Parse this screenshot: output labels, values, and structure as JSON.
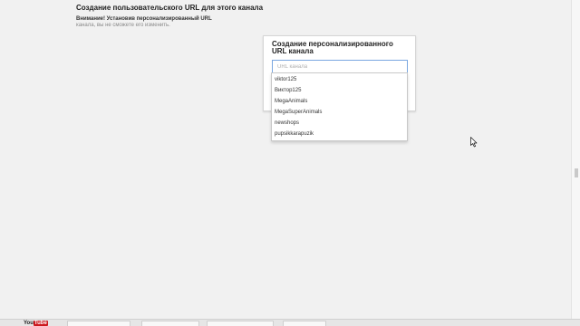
{
  "heading": "Создание пользовательского URL для этого канала",
  "warning": {
    "label": "Внимание! Установив персонализированный URL",
    "line2": "канала, вы не сможете его изменить."
  },
  "dialog": {
    "title": "Создание персонализированного URL канала",
    "input_placeholder": "URL канала",
    "input_value": ""
  },
  "suggestions": [
    "viktor125",
    "Виктор125",
    "MegaAnimals",
    "MegaSuperAnimals",
    "newshops",
    "pupsikkarapuzik"
  ],
  "footer": {
    "logo_you": "You",
    "logo_tube": "Tube"
  },
  "colors": {
    "page_bg": "#f1f1f1",
    "input_focus_border": "#7aa7e0",
    "youtube_red": "#cc181e"
  }
}
